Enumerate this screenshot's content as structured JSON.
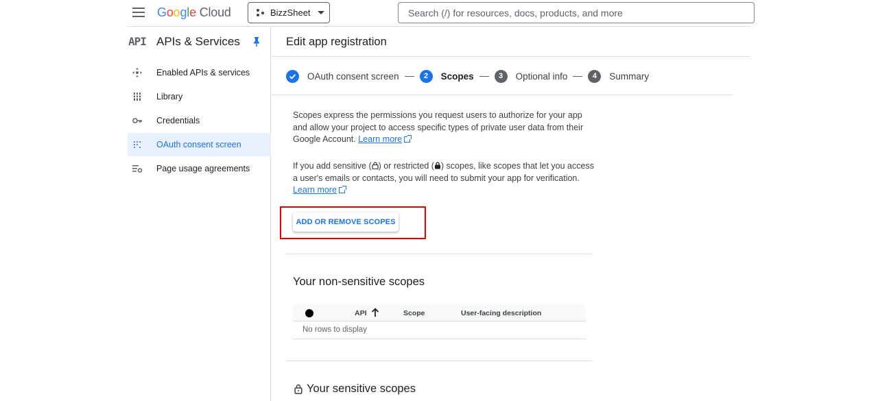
{
  "header": {
    "logo": {
      "google_letters": [
        "G",
        "o",
        "o",
        "g",
        "l",
        "e"
      ],
      "product": "Cloud"
    },
    "project": {
      "name": "BizzSheet"
    },
    "search": {
      "placeholder": "Search (/) for resources, docs, products, and more"
    }
  },
  "sidebar": {
    "badge": "API",
    "title": "APIs & Services",
    "items": [
      {
        "label": "Enabled APIs & services",
        "icon": "enabled-apis-icon"
      },
      {
        "label": "Library",
        "icon": "library-icon"
      },
      {
        "label": "Credentials",
        "icon": "key-icon"
      },
      {
        "label": "OAuth consent screen",
        "icon": "oauth-consent-icon",
        "active": true
      },
      {
        "label": "Page usage agreements",
        "icon": "page-usage-icon"
      }
    ]
  },
  "main": {
    "title": "Edit app registration",
    "stepper": {
      "steps": [
        {
          "number": "",
          "label": "OAuth consent screen",
          "state": "done"
        },
        {
          "number": "2",
          "label": "Scopes",
          "state": "current"
        },
        {
          "number": "3",
          "label": "Optional info",
          "state": "todo"
        },
        {
          "number": "4",
          "label": "Summary",
          "state": "todo"
        }
      ]
    },
    "intro": {
      "text": "Scopes express the permissions you request users to authorize for your app and allow your project to access specific types of private user data from their Google Account.",
      "link": "Learn more"
    },
    "sensitive_note": {
      "part1": "If you add sensitive (",
      "part2": ") or restricted (",
      "part3": ") scopes, like scopes that let you access a user's emails or contacts, you will need to submit your app for verification.",
      "link": "Learn more"
    },
    "add_scopes_button": "ADD OR REMOVE SCOPES",
    "non_sensitive": {
      "title": "Your non-sensitive scopes",
      "columns": {
        "api": "API",
        "scope": "Scope",
        "description": "User-facing description"
      },
      "empty": "No rows to display"
    },
    "sensitive": {
      "title": "Your sensitive scopes"
    }
  },
  "colors": {
    "accent": "#1a73e8",
    "highlight": "#e00000",
    "active_bg": "#e8f0fe"
  }
}
